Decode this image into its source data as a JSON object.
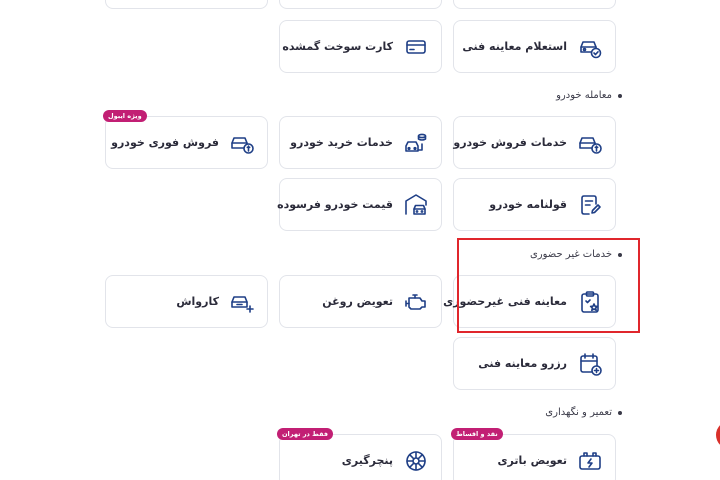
{
  "sections": {
    "car_deal": "معامله خودرو",
    "remote": "خدمات غیر حضوری",
    "repair": "تعمیر و نگهداری"
  },
  "cards": {
    "inquiry_inspection": "استعلام معاینه فنی",
    "lost_fuel_card": "کارت سوخت گمشده",
    "sell_services": "خدمات فروش خودرو",
    "buy_services": "خدمات خرید خودرو",
    "instant_sale": "فروش فوری خودرو",
    "car_contract": "قولنامه خودرو",
    "used_price": "قیمت خودرو فرسوده",
    "remote_inspection": "معاینه فنی غیرحضوری",
    "oil_change": "تعویض روغن",
    "car_wash": "کارواش",
    "reserve_inspection": "رزرو معاینه فنی",
    "battery_change": "تعویض باتری",
    "puncture": "پنچرگیری"
  },
  "badges": {
    "instant_sale": "ویژه ایبول",
    "battery": "نقد و اقساط",
    "puncture": "فقط در تهران"
  },
  "colors": {
    "accent": "#1f3f86",
    "badge": "#c21f74",
    "highlight": "#e0262c"
  }
}
